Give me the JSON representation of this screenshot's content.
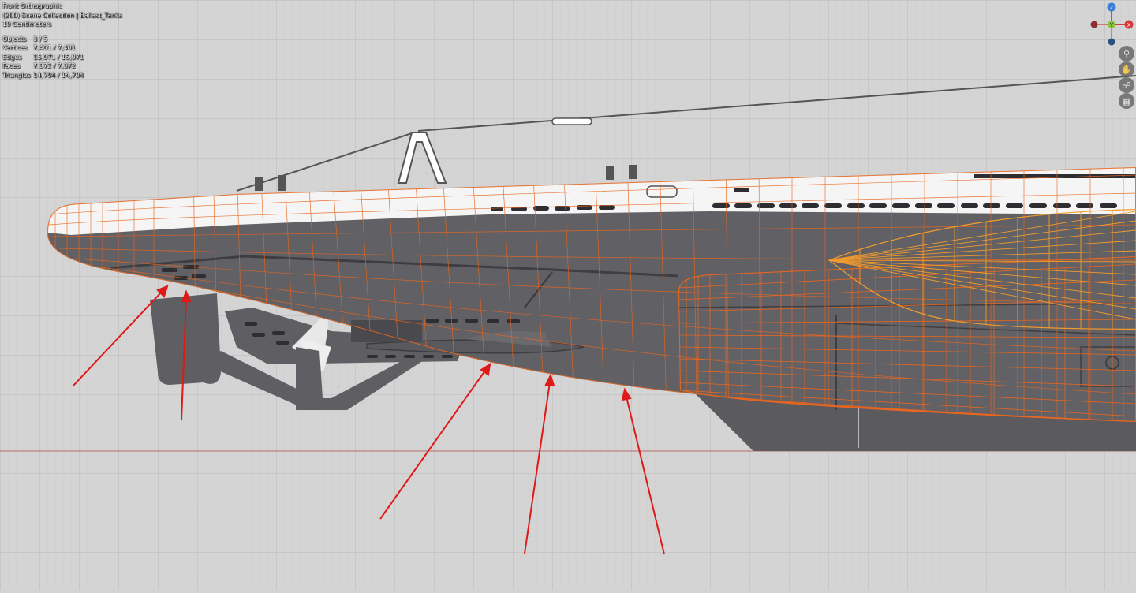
{
  "viewport": {
    "view_name": "Front Orthographic",
    "collection": "(200) Scene Collection | Ballast_Tanks",
    "grid_scale": "10 Centimeters"
  },
  "stats": [
    {
      "label": "Objects",
      "value": "3 / 5"
    },
    {
      "label": "Vertices",
      "value": "7,401 / 7,401"
    },
    {
      "label": "Edges",
      "value": "15,071 / 15,071"
    },
    {
      "label": "Faces",
      "value": "7,372 / 7,372"
    },
    {
      "label": "Triangles",
      "value": "14,704 / 14,704"
    }
  ],
  "gizmo": {
    "z": "Z",
    "y": "Y",
    "x": "X"
  },
  "nav_tools": [
    {
      "name": "zoom-icon",
      "glyph": "⚲"
    },
    {
      "name": "pan-hand-icon",
      "glyph": "✋"
    },
    {
      "name": "camera-icon",
      "glyph": "⎔"
    },
    {
      "name": "grid-perspective-icon",
      "glyph": "▦"
    }
  ],
  "colors": {
    "background": "#d4d4d4",
    "hull": "#616065",
    "deck": "#f4f4f4",
    "wire_selected": "#e8661e",
    "wire_active": "#f29b2c",
    "arrow": "#e01818",
    "axis_x": "#d63a3a",
    "axis_y": "#8ac43c",
    "axis_z": "#3a7fd6"
  }
}
